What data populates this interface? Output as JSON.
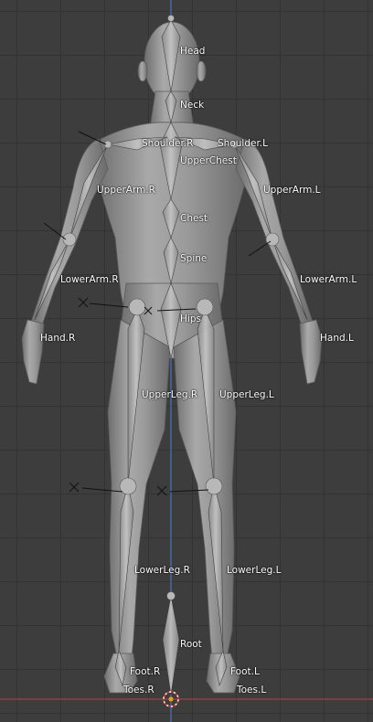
{
  "viewport": {
    "background": "#3d3d3d",
    "grid_color": "#333333",
    "y_axis_color": "#4a7fd4",
    "x_axis_color": "#c04040"
  },
  "bones": {
    "head": "Head",
    "neck": "Neck",
    "shoulder_r": "Shoulder.R",
    "shoulder_l": "Shoulder.L",
    "upper_chest": "UpperChest",
    "upper_arm_r": "UpperArm.R",
    "upper_arm_l": "UpperArm.L",
    "chest": "Chest",
    "spine": "Spine",
    "lower_arm_r": "LowerArm.R",
    "lower_arm_l": "LowerArm.L",
    "hips": "Hips",
    "hand_r": "Hand.R",
    "hand_l": "Hand.L",
    "upper_leg_r": "UpperLeg.R",
    "upper_leg_l": "UpperLeg.L",
    "lower_leg_r": "LowerLeg.R",
    "lower_leg_l": "LowerLeg.L",
    "root": "Root",
    "foot_r": "Foot.R",
    "foot_l": "Foot.L",
    "toes_r": "Toes.R",
    "toes_l": "Toes.L"
  },
  "icons": [
    "3d-cursor-icon",
    "ik-target-icon"
  ]
}
